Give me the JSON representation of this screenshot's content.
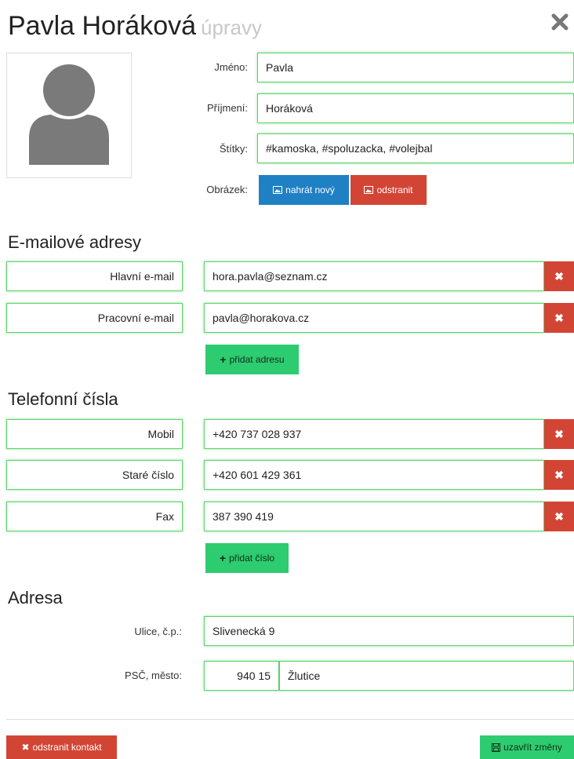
{
  "header": {
    "name": "Pavla Horáková",
    "subtitle": "úpravy"
  },
  "profile": {
    "first_name_label": "Jméno:",
    "first_name": "Pavla",
    "last_name_label": "Příjmení:",
    "last_name": "Horáková",
    "tags_label": "Štítky:",
    "tags": "#kamoska, #spoluzacka, #volejbal",
    "image_label": "Obrázek:",
    "upload_label": "nahrát nový",
    "remove_label": "odstranit"
  },
  "emails": {
    "title": "E-mailové adresy",
    "items": [
      {
        "label": "Hlavní e-mail",
        "value": "hora.pavla@seznam.cz"
      },
      {
        "label": "Pracovní e-mail",
        "value": "pavla@horakova.cz"
      }
    ],
    "add_label": "přidat adresu"
  },
  "phones": {
    "title": "Telefonní čísla",
    "items": [
      {
        "label": "Mobil",
        "value": "+420 737 028 937"
      },
      {
        "label": "Staré číslo",
        "value": "+420 601 429 361"
      },
      {
        "label": "Fax",
        "value": "387 390 419"
      }
    ],
    "add_label": "přidat číslo"
  },
  "address": {
    "title": "Adresa",
    "street_label": "Ulice, č.p.:",
    "street": "Slivenecká 9",
    "zip_city_label": "PSČ, město:",
    "zip": "940 15",
    "city": "Žlutice"
  },
  "footer": {
    "delete_label": "odstranit kontakt",
    "save_label": "uzavřít změny"
  },
  "icons": {
    "close": "close-icon",
    "plus": "plus-icon",
    "image": "image-icon",
    "save": "floppy-icon"
  },
  "colors": {
    "blue": "#1f80c4",
    "red": "#d24535",
    "green": "#2ecc71",
    "field_border": "#5fd36a"
  }
}
